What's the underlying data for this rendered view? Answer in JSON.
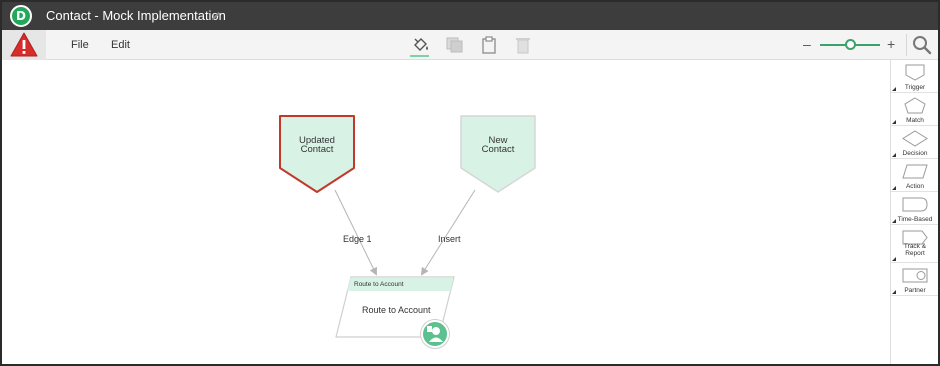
{
  "window": {
    "title": "Contact - Mock Implementation",
    "logo_letter": "D"
  },
  "menu": {
    "file": "File",
    "edit": "Edit"
  },
  "toolbar": {
    "tools": [
      "paint-bucket-icon",
      "copy-icon",
      "paste-icon",
      "trash-icon"
    ],
    "zoom_minus": "–",
    "zoom_plus": "+",
    "zoom_level": 0.5
  },
  "canvas": {
    "nodes": [
      {
        "id": "updated",
        "text_line1": "Updated",
        "text_line2": "Contact",
        "border_color": "#c0392b",
        "fill_color": "#d9f2e6"
      },
      {
        "id": "new",
        "text_line1": "New",
        "text_line2": "Contact",
        "border_color": "#d6d6d6",
        "fill_color": "#d9f2e6"
      }
    ],
    "edges": [
      {
        "label": "Edge 1"
      },
      {
        "label": "Insert"
      }
    ],
    "route_node": {
      "header": "Route to Account",
      "text": "Route to Account",
      "header_color": "#d9f2e6",
      "badge_color": "#5cc08f"
    }
  },
  "palette": {
    "items": [
      {
        "label": "Trigger",
        "shape": "trigger-shape"
      },
      {
        "label": "Match",
        "shape": "match-shape"
      },
      {
        "label": "Decision",
        "shape": "decision-shape"
      },
      {
        "label": "Action",
        "shape": "action-shape"
      },
      {
        "label": "Time-Based",
        "shape": "time-based-shape"
      },
      {
        "label_line1": "Track &",
        "label_line2": "Report",
        "shape": "track-report-shape"
      },
      {
        "label": "Partner",
        "shape": "partner-shape"
      }
    ]
  },
  "colors": {
    "brand": "#23a85a",
    "alert": "#d62c2c",
    "accent": "#3aa36b",
    "titlebar": "#3d3d3d"
  }
}
